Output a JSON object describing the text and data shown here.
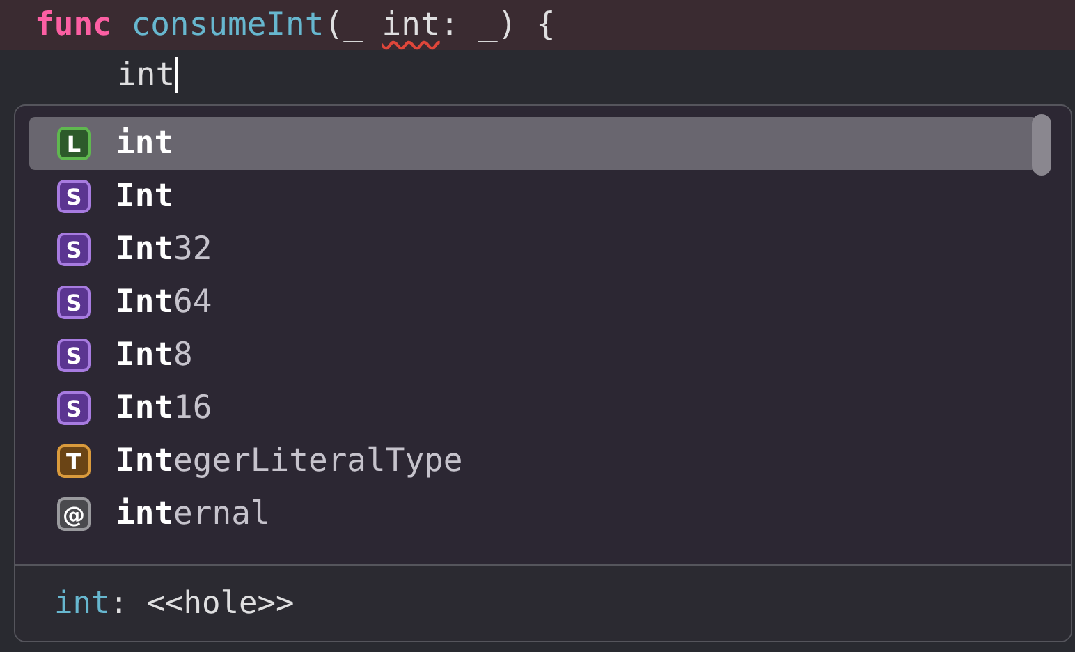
{
  "editor": {
    "lines": [
      {
        "error": true,
        "tokens": [
          {
            "text": "func",
            "kind": "keyword"
          },
          {
            "text": " consumeInt",
            "kind": "name"
          },
          {
            "text": "(_ ",
            "kind": "plain"
          },
          {
            "text": "int",
            "kind": "flagged"
          },
          {
            "text": ": _) {",
            "kind": "plain"
          }
        ]
      },
      {
        "error": false,
        "indent": true,
        "cursor": true,
        "tokens": [
          {
            "text": "int",
            "kind": "plain"
          }
        ]
      }
    ]
  },
  "completions": {
    "items": [
      {
        "badge": "L",
        "kind": "local",
        "match": "int",
        "selected": true
      },
      {
        "badge": "S",
        "kind": "struct",
        "match": "Int",
        "selected": false
      },
      {
        "badge": "S",
        "kind": "struct",
        "match": "Int",
        "rest": "32",
        "selected": false
      },
      {
        "badge": "S",
        "kind": "struct",
        "match": "Int",
        "rest": "64",
        "selected": false
      },
      {
        "badge": "S",
        "kind": "struct",
        "match": "Int",
        "rest": "8",
        "selected": false
      },
      {
        "badge": "S",
        "kind": "struct",
        "match": "Int",
        "rest": "16",
        "selected": false
      },
      {
        "badge": "T",
        "kind": "typealias",
        "match": "Int",
        "rest": "egerLiteralType",
        "selected": false
      },
      {
        "badge": "@",
        "kind": "attribute",
        "match": "int",
        "rest": "ernal",
        "selected": false
      }
    ],
    "signature": {
      "name": "int",
      "rest": ": <<hole>>"
    }
  }
}
